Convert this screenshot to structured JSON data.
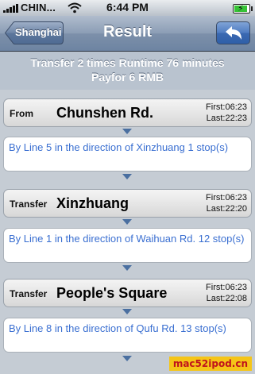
{
  "status_bar": {
    "carrier": "CHIN...",
    "time": "6:44 PM",
    "signal_icon": "signal-bars-icon",
    "wifi_icon": "wifi-icon",
    "battery_icon": "battery-charging-icon",
    "battery_level": 0.85
  },
  "nav": {
    "back_label": "Shanghai",
    "title": "Result",
    "return_icon": "return-arrow-icon"
  },
  "summary": {
    "line1": "Transfer 2 times  Runtime 76 minutes",
    "line2": "Payfor 6 RMB"
  },
  "stations": [
    {
      "kind": "From",
      "name": "Chunshen Rd.",
      "first": "First:06:23",
      "last": "Last:22:23"
    },
    {
      "kind": "Transfer",
      "name": "Xinzhuang",
      "first": "First:06:23",
      "last": "Last:22:20"
    },
    {
      "kind": "Transfer",
      "name": "People's Square",
      "first": "First:06:23",
      "last": "Last:22:08"
    }
  ],
  "routes": [
    {
      "text": "By Line 5 in the direction of Xinzhuang 1 stop(s)"
    },
    {
      "text": "By Line 1 in the direction of Waihuan Rd. 12 stop(s)"
    },
    {
      "text": "By Line 8 in the direction of Qufu Rd. 13 stop(s)"
    }
  ],
  "watermark": "mac52ipod.cn",
  "colors": {
    "nav_bar": "#7d90aa",
    "route_text": "#3a6fd1",
    "arrow": "#4a6fa0",
    "watermark_bg": "#f5c518",
    "watermark_text": "#c0141c"
  }
}
